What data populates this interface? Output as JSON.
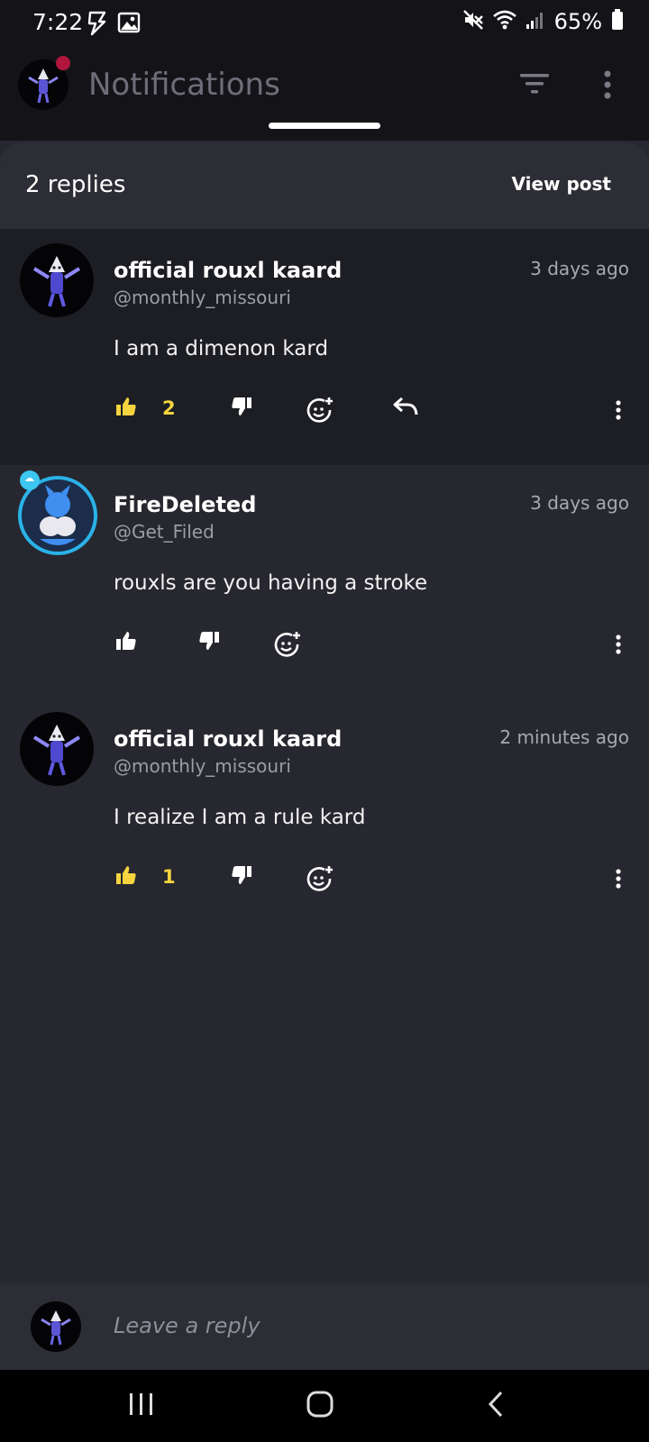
{
  "status_bar": {
    "time": "7:22",
    "battery": "65%",
    "icons": [
      "flash-icon",
      "image-icon",
      "mute-icon",
      "wifi-icon",
      "signal-icon",
      "battery-icon"
    ]
  },
  "header": {
    "title": "Notifications",
    "icons": [
      "filter-icon",
      "more-vertical-icon"
    ],
    "notification_dot_color": "#b0163d"
  },
  "sheet": {
    "replies_label": "2 replies",
    "view_post_label": "View post"
  },
  "comments": [
    {
      "author": "official rouxl kaard",
      "handle": "@monthly_missouri",
      "time": "3 days ago",
      "text": "I am a dimenon kard",
      "likes": "2",
      "liked": true,
      "has_reply_button": true,
      "highlighted": true
    },
    {
      "author": "FireDeleted",
      "handle": "@Get_Filed",
      "time": "3 days ago",
      "text": "rouxls are you having a stroke",
      "likes": "",
      "liked": false,
      "has_reply_button": false,
      "highlighted": false
    },
    {
      "author": "official rouxl kaard",
      "handle": "@monthly_missouri",
      "time": "2 minutes ago",
      "text": "I realize I am a rule kard",
      "likes": "1",
      "liked": true,
      "has_reply_button": false,
      "highlighted": false
    }
  ],
  "reply_bar": {
    "placeholder": "Leave a reply"
  },
  "nav_bar": {
    "icons": [
      "recent-apps-icon",
      "home-icon",
      "back-icon"
    ]
  },
  "colors": {
    "accent_like": "#f5d43f",
    "background": "#27272f",
    "highlight": "#1d1e24",
    "avatar_ring": "#2ab3e8"
  }
}
